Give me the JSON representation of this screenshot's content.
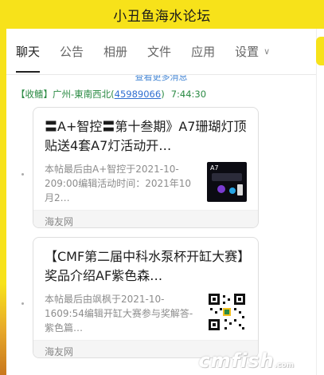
{
  "window": {
    "title": "小丑鱼海水论坛"
  },
  "tabs": [
    {
      "label": "聊天",
      "active": true
    },
    {
      "label": "公告"
    },
    {
      "label": "相册"
    },
    {
      "label": "文件"
    },
    {
      "label": "应用"
    },
    {
      "label": "设置",
      "has_dropdown": true
    }
  ],
  "load_more_text": "查看更多消息",
  "message": {
    "sender": "【收鳍】广州-東南西北",
    "sender_id": "45989066",
    "time": "7:44:30"
  },
  "cards": [
    {
      "title": "〓A+智控〓第十叁期》A7珊瑚灯顶贴送4套A7灯活动开…",
      "desc": "本帖最后由A+智控于2021-10-209:00编辑活动时间：2021年10月2…",
      "thumb_text": "A7",
      "source": "海友网"
    },
    {
      "title": "【CMF第二届中科水泵杯开缸大赛】奖品介绍AF紫色森…",
      "desc": "本帖最后由飒枫于2021-10-1609:54编辑开缸大赛参与奖解答-紫色篇…",
      "source": "海友网"
    }
  ],
  "watermark": {
    "brand": "cmfish",
    "suffix": ".com"
  },
  "colors": {
    "brand_yellow": "#f7e21a",
    "link_blue": "#2f6fd1",
    "sender_green": "#2a8a43"
  }
}
